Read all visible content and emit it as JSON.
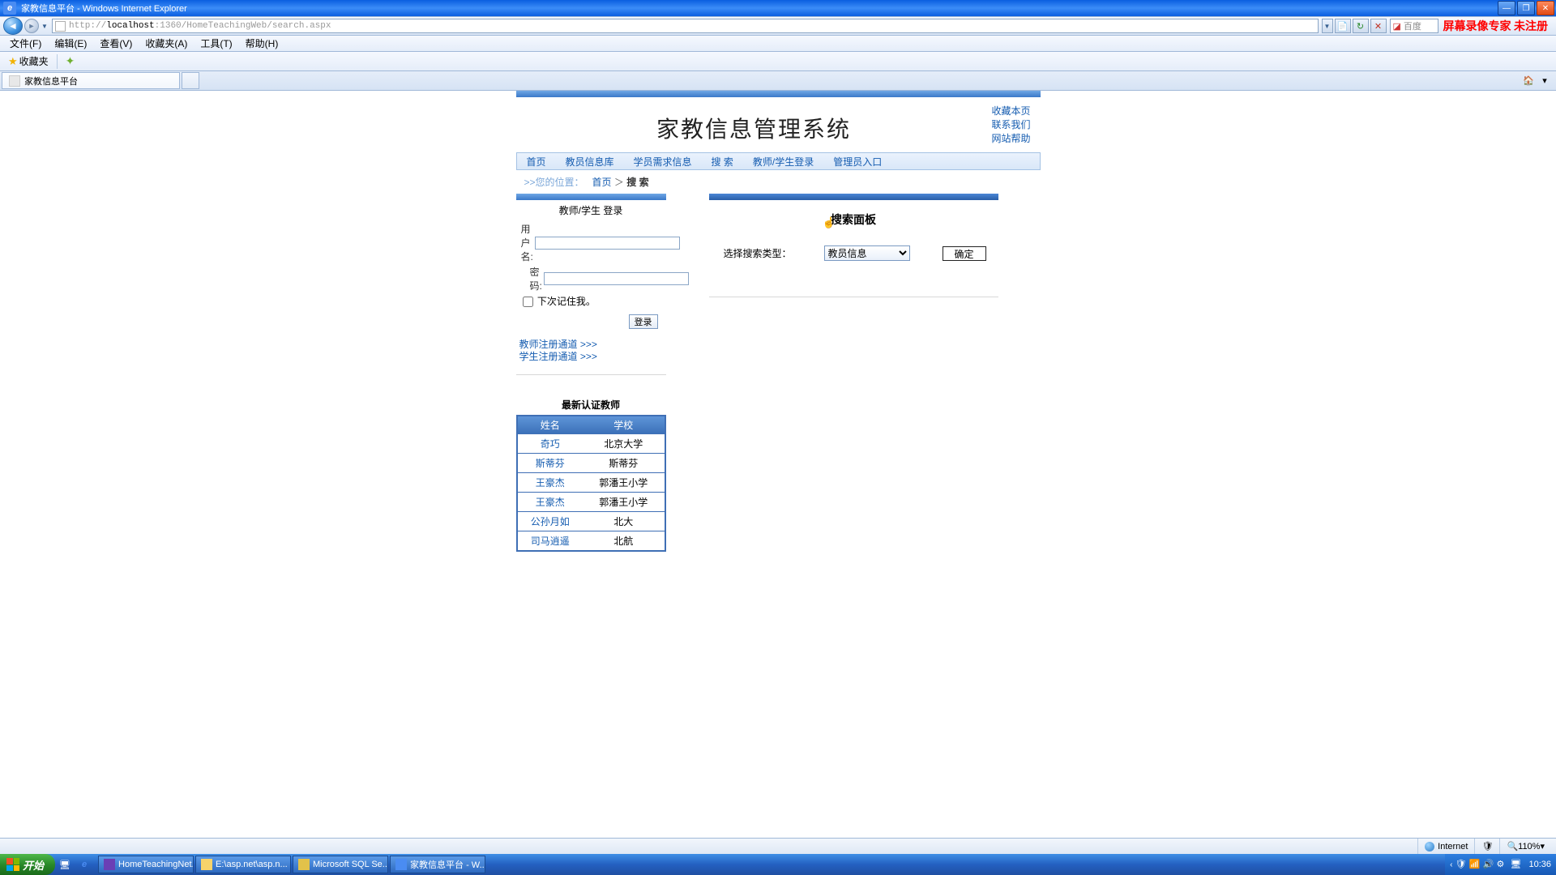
{
  "window": {
    "title": "家教信息平台 - Windows Internet Explorer",
    "recorder_banner": "屏幕录像专家 未注册"
  },
  "nav": {
    "url_host": "localhost",
    "url_proto": "http://",
    "url_path": ":1360/HomeTeachingWeb/search.aspx",
    "search_engine": "百度"
  },
  "menu": [
    "文件(F)",
    "编辑(E)",
    "查看(V)",
    "收藏夹(A)",
    "工具(T)",
    "帮助(H)"
  ],
  "favbar": {
    "label": "收藏夹"
  },
  "tab": {
    "title": "家教信息平台"
  },
  "page": {
    "site_title": "家教信息管理系统",
    "header_links": [
      "收藏本页",
      "联系我们",
      "网站帮助"
    ],
    "nav_items": [
      "首页",
      "教员信息库",
      "学员需求信息",
      "搜 索",
      "教师/学生登录",
      "管理员入口"
    ],
    "breadcrumb": {
      "prefix": ">>您的位置：",
      "home": "首页",
      "sep": "＞",
      "current": "搜 索"
    },
    "login": {
      "title": "教师/学生 登录",
      "user_label": "用户名:",
      "pwd_label": "密码:",
      "remember": "下次记住我。",
      "btn": "登录",
      "reg_teacher": "教师注册通道 >>>",
      "reg_student": "学生注册通道 >>>"
    },
    "teachers": {
      "title": "最新认证教师",
      "col_name": "姓名",
      "col_school": "学校",
      "rows": [
        {
          "name": "奇巧",
          "school": "北京大学"
        },
        {
          "name": "斯蒂芬",
          "school": "斯蒂芬"
        },
        {
          "name": "王豪杰",
          "school": "郭潘王小学"
        },
        {
          "name": "王豪杰",
          "school": "郭潘王小学"
        },
        {
          "name": "公孙月如",
          "school": "北大"
        },
        {
          "name": "司马逍遥",
          "school": "北航"
        }
      ]
    },
    "search": {
      "panel_title": "搜索面板",
      "type_label": "选择搜索类型：",
      "selected": "教员信息",
      "btn": "确定"
    }
  },
  "status": {
    "zone": "Internet",
    "zoom": "110%"
  },
  "taskbar": {
    "start": "开始",
    "items": [
      "HomeTeachingNet...",
      "E:\\asp.net\\asp.n...",
      "Microsoft SQL Se...",
      "家教信息平台 - W..."
    ],
    "clock": "10:36"
  }
}
